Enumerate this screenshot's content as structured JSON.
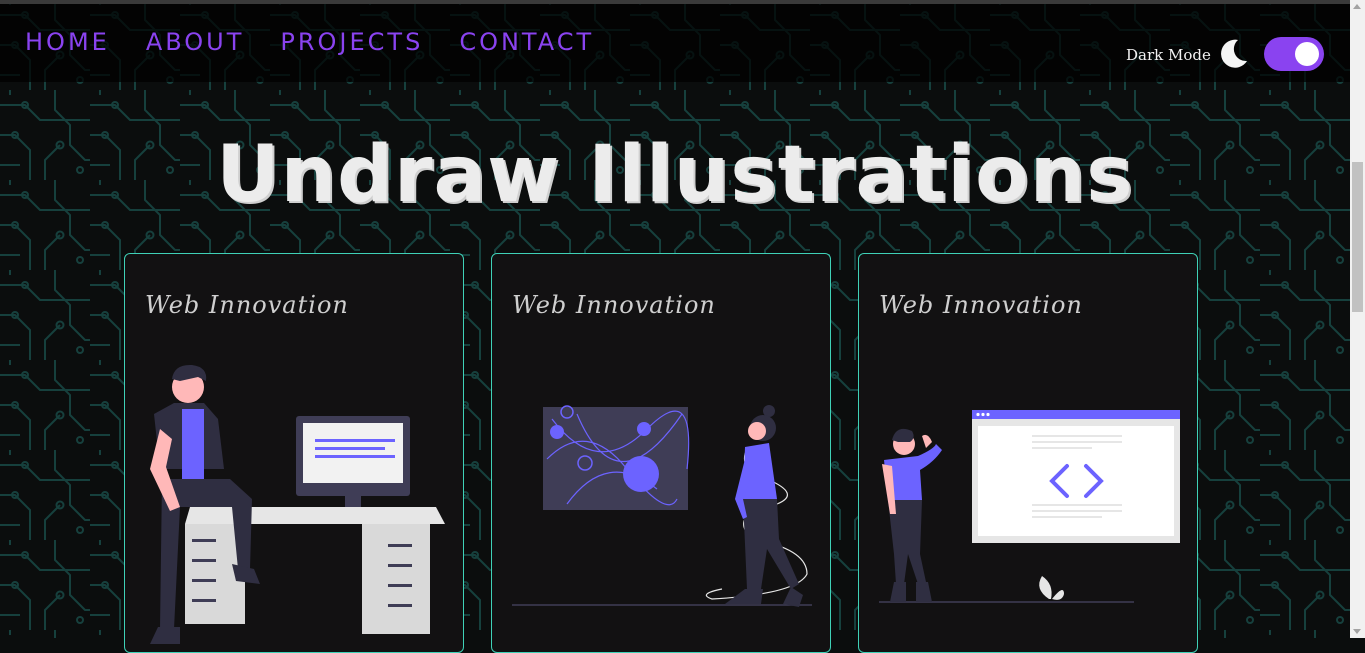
{
  "nav": {
    "items": [
      {
        "label": "HOME"
      },
      {
        "label": "ABOUT"
      },
      {
        "label": "PROJECTS"
      },
      {
        "label": "CONTACT"
      }
    ],
    "dark_mode_label": "Dark Mode",
    "dark_mode_on": true
  },
  "hero": {
    "title": "Undraw Illustrations"
  },
  "cards": [
    {
      "title": "Web  Innovation",
      "illustration": "person-sitting-at-desk-with-computer"
    },
    {
      "title": "Web  Innovation",
      "illustration": "woman-walking-past-abstract-board"
    },
    {
      "title": "Web  Innovation",
      "illustration": "woman-next-to-code-browser-window"
    }
  ],
  "colors": {
    "accent": "#8a43f0",
    "card_border": "#3fd1b7",
    "illustration_purple": "#6c63ff",
    "background": "#0b0d0d"
  }
}
